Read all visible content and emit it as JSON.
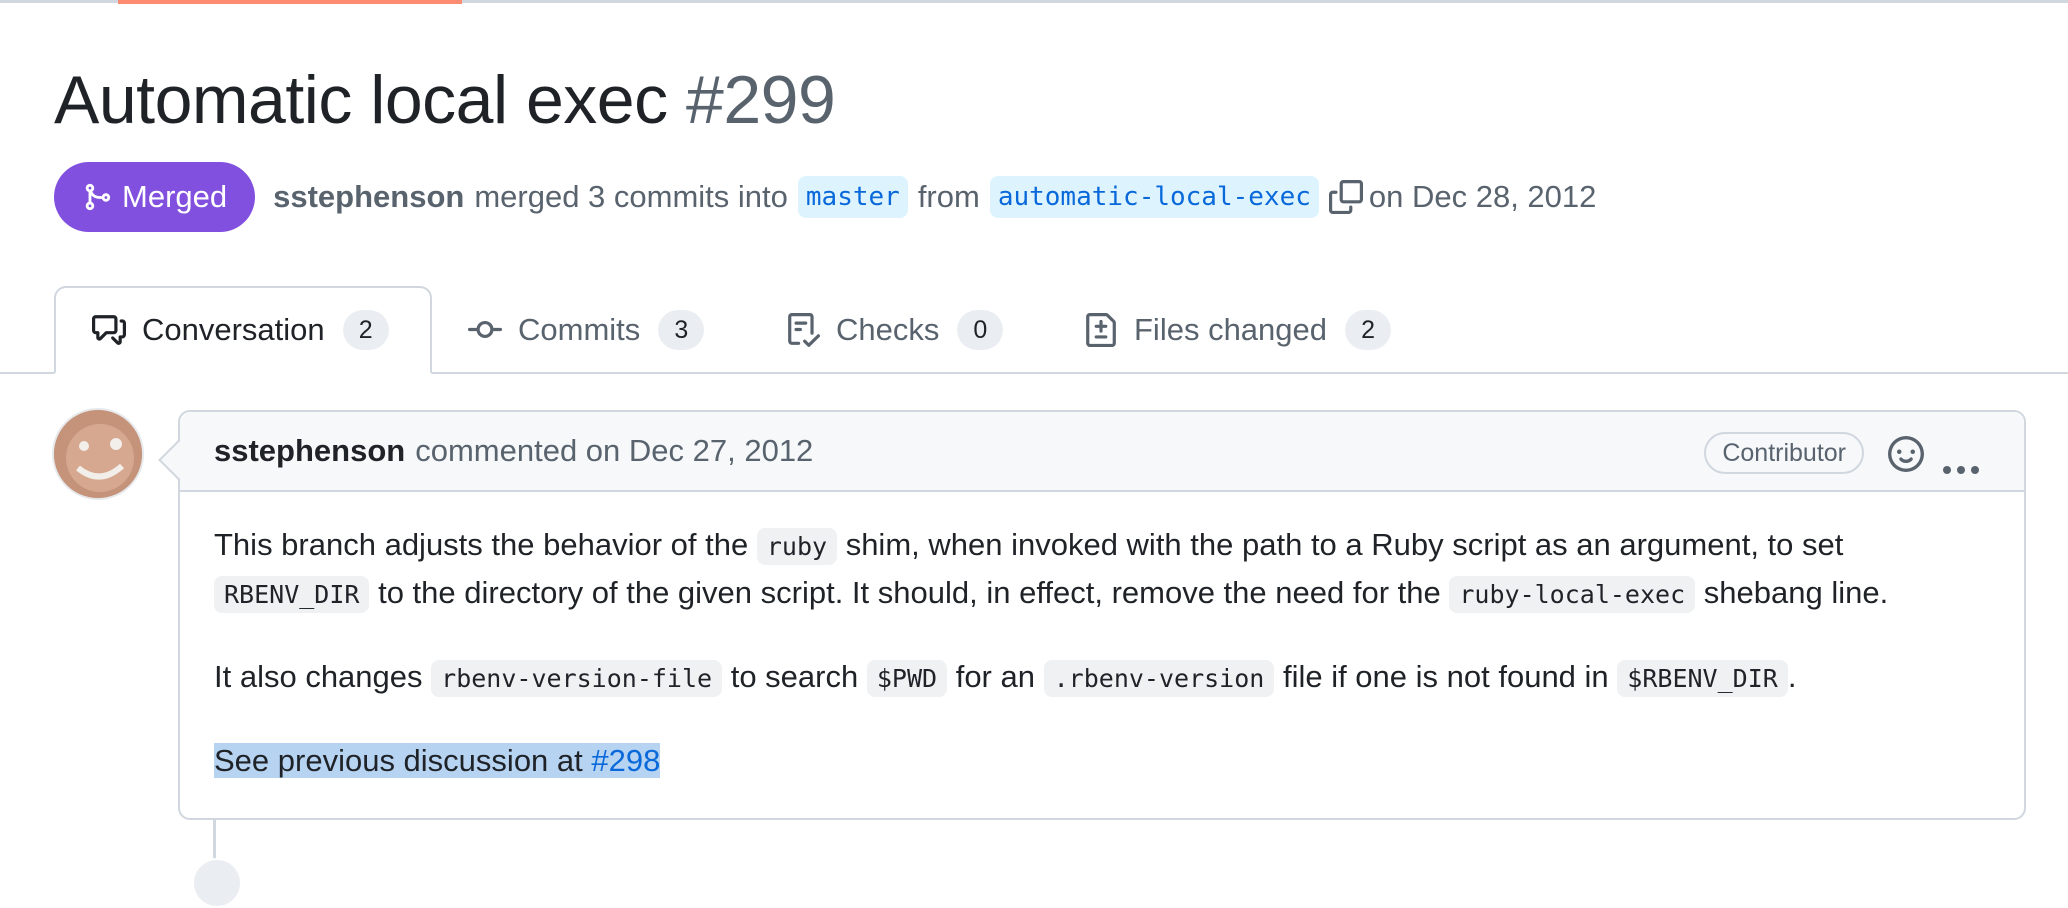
{
  "pr": {
    "title": "Automatic local exec",
    "number": "#299",
    "state_label": "Merged",
    "author": "sstephenson",
    "merge_text": "merged 3 commits into",
    "base_branch": "master",
    "from_text": "from",
    "head_branch": "automatic-local-exec",
    "date_text": "on Dec 28, 2012"
  },
  "tabs": [
    {
      "label": "Conversation",
      "count": "2",
      "icon": "comment-discussion-icon"
    },
    {
      "label": "Commits",
      "count": "3",
      "icon": "git-commit-icon"
    },
    {
      "label": "Checks",
      "count": "0",
      "icon": "checklist-icon"
    },
    {
      "label": "Files changed",
      "count": "2",
      "icon": "file-diff-icon"
    }
  ],
  "comment": {
    "author": "sstephenson",
    "meta": "commented on Dec 27, 2012",
    "role": "Contributor",
    "p1": {
      "t1": "This branch adjusts the behavior of the",
      "c1": "ruby",
      "t2": "shim, when invoked with the path to a Ruby script as an argument, to set",
      "c2": "RBENV_DIR",
      "t3": "to the directory of the given script. It should, in effect, remove the need for the",
      "c3": "ruby-local-exec",
      "t4": "shebang line."
    },
    "p2": {
      "t1": "It also changes",
      "c1": "rbenv-version-file",
      "t2": "to search",
      "c2": "$PWD",
      "t3": "for an",
      "c3": ".rbenv-version",
      "t4": "file if one is not found in",
      "c4": "$RBENV_DIR",
      "t5": "."
    },
    "p3": {
      "t1": "See previous discussion at",
      "link": "#298"
    }
  },
  "colors": {
    "merged": "#8250df",
    "link": "#0969da",
    "selection": "#b6d3f2",
    "tab_accent": "#fd8c73"
  }
}
